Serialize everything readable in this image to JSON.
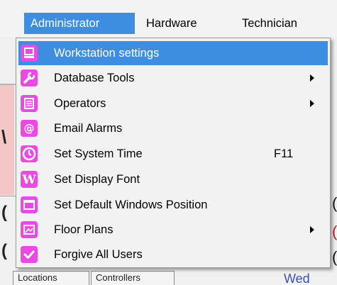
{
  "menubar": {
    "items": [
      {
        "label": "Administrator",
        "active": true
      },
      {
        "label": "Hardware"
      },
      {
        "label": "Technician"
      }
    ]
  },
  "dropdown": {
    "items": [
      {
        "label": "Workstation settings",
        "icon": "monitor-icon",
        "highlighted": true
      },
      {
        "label": "Database Tools",
        "icon": "wrench-icon",
        "submenu": true
      },
      {
        "label": "Operators",
        "icon": "operators-list-icon",
        "submenu": true
      },
      {
        "label": "Email Alarms",
        "icon": "email-at-icon"
      },
      {
        "label": "Set System Time",
        "icon": "clock-icon",
        "shortcut": "F11"
      },
      {
        "label": "Set Display Font",
        "icon": "font-w-icon"
      },
      {
        "label": "Set Default Windows Position",
        "icon": "window-icon"
      },
      {
        "label": "Floor Plans",
        "icon": "floor-plan-icon",
        "submenu": true
      },
      {
        "label": "Forgive All Users",
        "icon": "checkmark-icon"
      }
    ]
  },
  "background": {
    "tabs": [
      "Locations",
      "Controllers"
    ],
    "status_text": "Wed",
    "left_glyphs": [
      "\\",
      "(",
      "("
    ],
    "right_glyphs": [
      "(",
      "(",
      "("
    ]
  },
  "colors": {
    "highlight": "#3d8ee0",
    "icon_bg": "#e94ae3",
    "menu_bg": "#f2f2f2"
  }
}
